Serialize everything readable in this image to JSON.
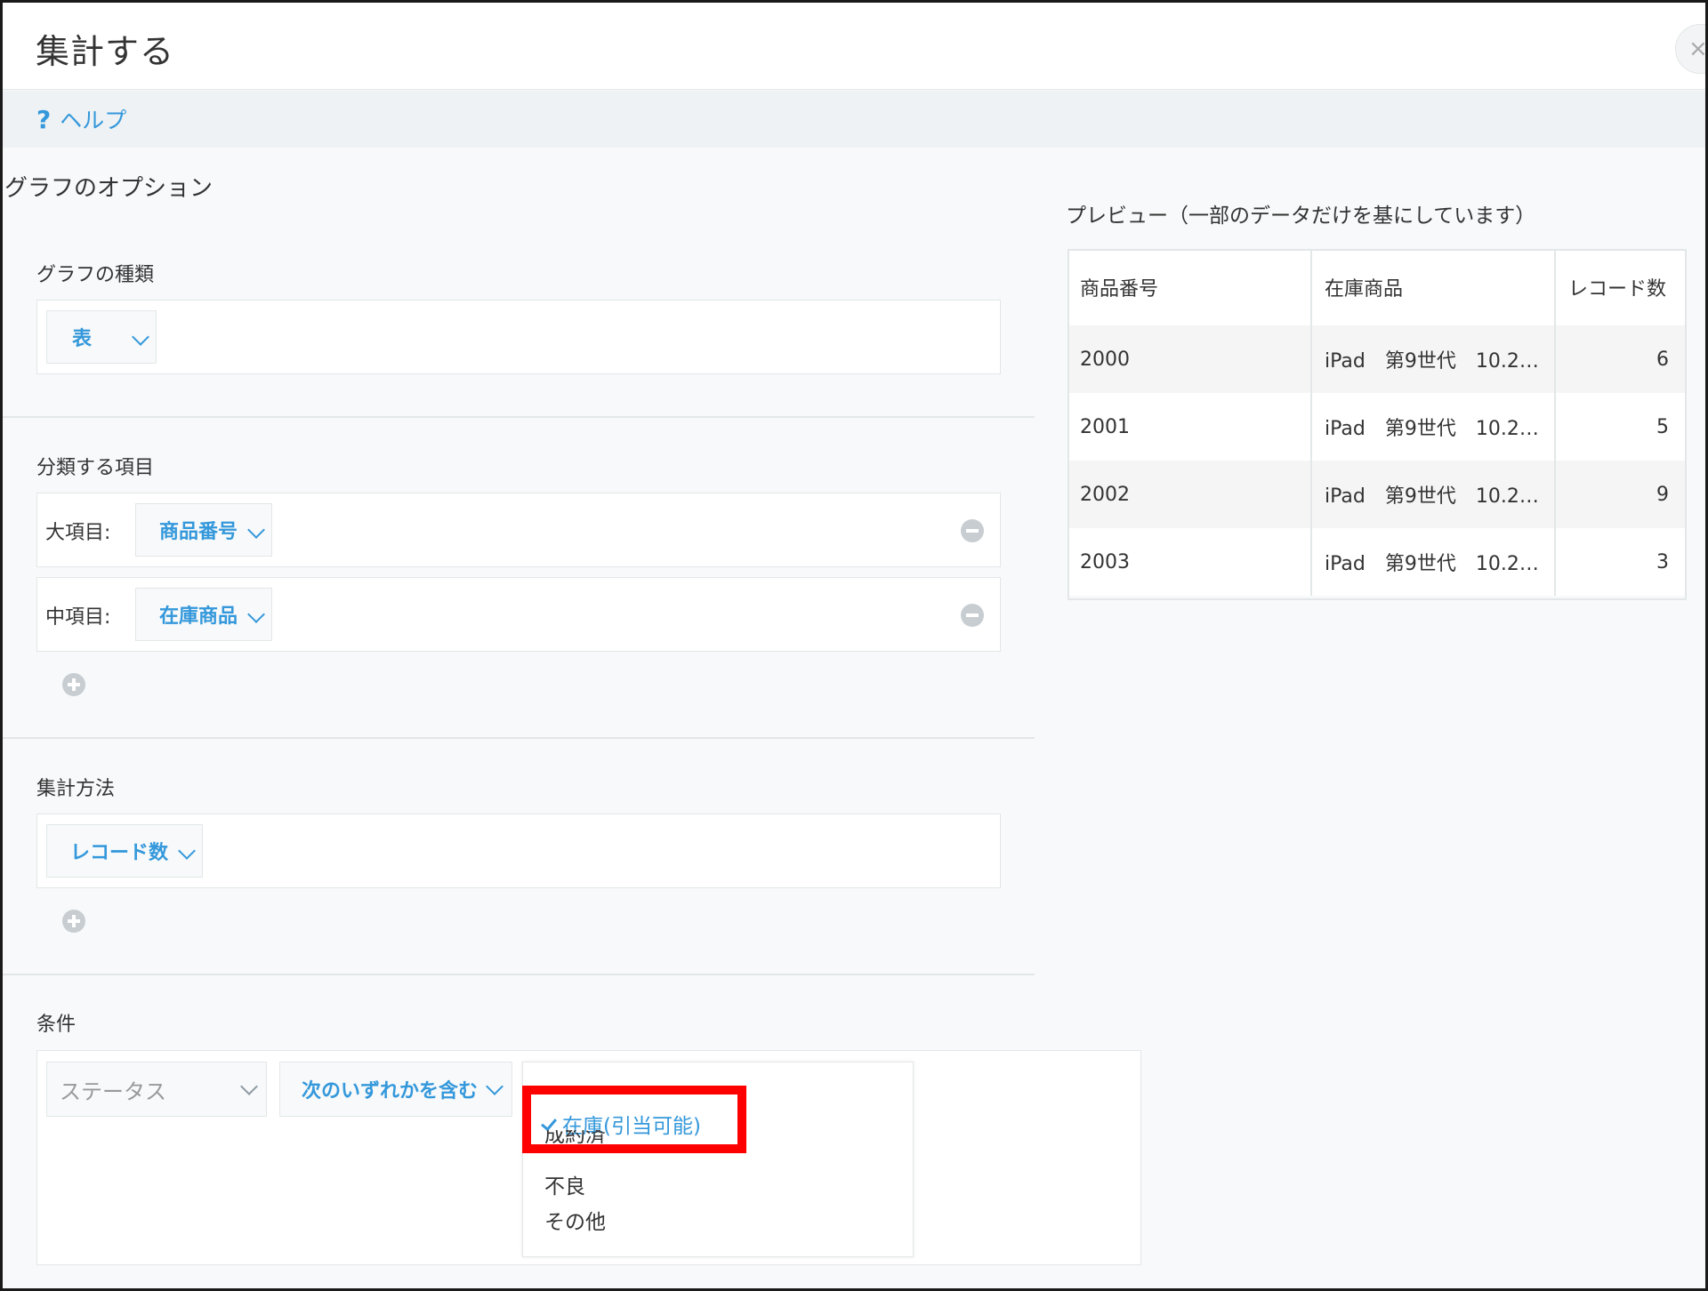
{
  "window": {
    "title": "集計する",
    "close_symbol": "×"
  },
  "help": {
    "icon": "?",
    "label": "ヘルプ"
  },
  "graph_options": {
    "title": "グラフのオプション"
  },
  "graph_type": {
    "label": "グラフの種類",
    "value": "表"
  },
  "classify": {
    "label": "分類する項目",
    "major_label": "大項目:",
    "major_value": "商品番号",
    "middle_label": "中項目:",
    "middle_value": "在庫商品"
  },
  "aggregate": {
    "label": "集計方法",
    "value": "レコード数"
  },
  "conditions": {
    "label": "条件",
    "field_placeholder": "ステータス",
    "operator": "次のいずれかを含む",
    "options": [
      {
        "label": "在庫(引当可能)",
        "selected": true
      },
      {
        "label": "成約済",
        "selected": false
      },
      {
        "label": "不良",
        "selected": false
      },
      {
        "label": "その他",
        "selected": false
      }
    ]
  },
  "preview": {
    "title": "プレビュー（一部のデータだけを基にしています）",
    "columns": [
      "商品番号",
      "在庫商品",
      "レコード数"
    ],
    "rows": [
      [
        "2000",
        "iPad　第9世代　10.2…",
        "6"
      ],
      [
        "2001",
        "iPad　第9世代　10.2…",
        "5"
      ],
      [
        "2002",
        "iPad　第9世代　10.2…",
        "9"
      ],
      [
        "2003",
        "iPad　第9世代　10.2…",
        "3"
      ]
    ]
  },
  "colors": {
    "accent": "#3498db",
    "highlight": "#ff0000",
    "border": "#e3e7e8",
    "background": "#f7f9fa"
  },
  "icons": {
    "help": "question-icon",
    "dropdown": "chevron-down-icon",
    "remove": "minus-circle-icon",
    "add": "plus-circle-icon",
    "selected": "check-icon"
  }
}
